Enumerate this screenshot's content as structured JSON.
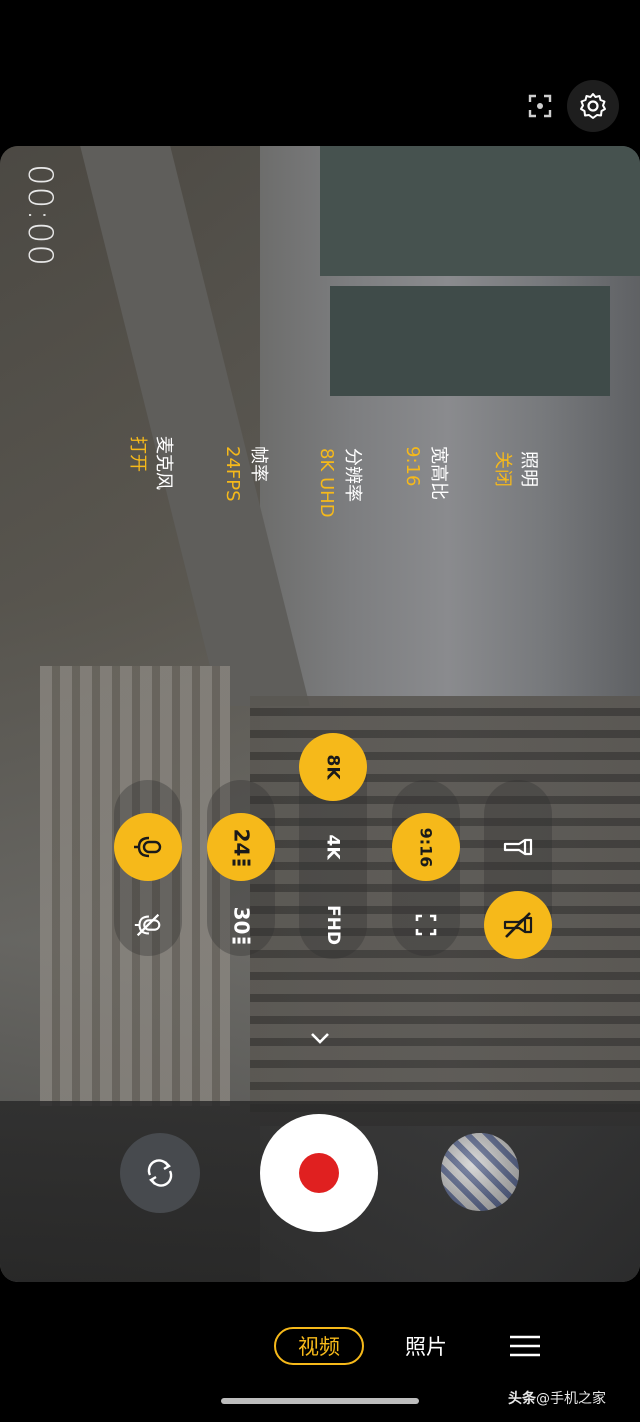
{
  "top_bar": {
    "focus_icon": "focus-frame-icon",
    "settings_icon": "gear-icon"
  },
  "timer": "00:00",
  "info": {
    "lighting": {
      "label": "照明",
      "value": "关闭"
    },
    "aspect": {
      "label": "宽高比",
      "value": "9:16"
    },
    "resolution": {
      "label": "分辨率",
      "value": "8K UHD"
    },
    "framerate": {
      "label": "帧率",
      "value": "24FPS"
    },
    "mic": {
      "label": "麦克风",
      "value": "打开"
    }
  },
  "controls": {
    "res_8k": "8K",
    "res_4k": "4K",
    "res_fhd": "FHD",
    "fps_24": "24",
    "fps_30": "30",
    "aspect_916": "9:16"
  },
  "modes": {
    "video": "视频",
    "photo": "照片"
  },
  "watermark": {
    "prefix": "头条",
    "handle": "@手机之家"
  },
  "colors": {
    "accent": "#f6b91a",
    "record": "#e02020"
  }
}
